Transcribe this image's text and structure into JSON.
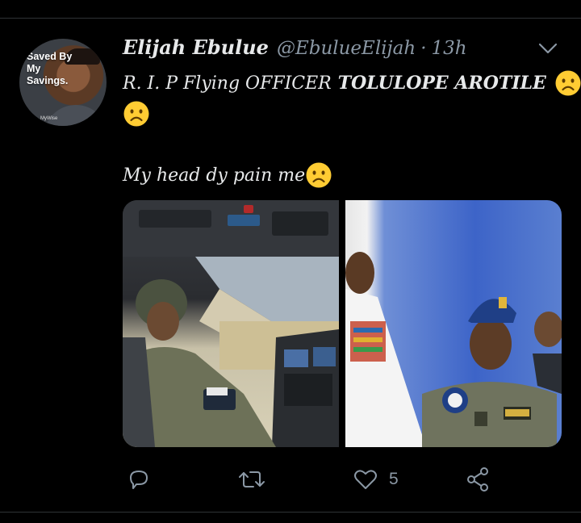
{
  "colors": {
    "background": "#000000",
    "text_primary": "#e7e9ea",
    "text_secondary": "#8b98a5",
    "divider": "#2f3336",
    "emoji_yellow": "#ffcc33"
  },
  "tweet": {
    "author": {
      "display_name": "Elijah Ebulue",
      "handle": "@EbulueElijah",
      "separator": "·",
      "time": "13h",
      "avatar_overlay_text": "Saved By My Savings.",
      "avatar_small_brand": "MyWise"
    },
    "text_line1_regular": "R. I. P Flying OFFICER",
    "text_line1_bold": "TOLULOPE AROTILE",
    "text_line2": "My head dy pain me",
    "emoji_name": "frowning-face-emoji",
    "media": [
      {
        "name": "photo-cockpit",
        "kind": "photo"
      },
      {
        "name": "photo-uniform",
        "kind": "photo"
      }
    ],
    "actions": {
      "reply_icon": "reply-icon",
      "retweet_icon": "retweet-icon",
      "like_icon": "like-icon",
      "like_count": "5",
      "share_icon": "share-icon"
    },
    "menu_icon": "chevron-down-icon"
  }
}
